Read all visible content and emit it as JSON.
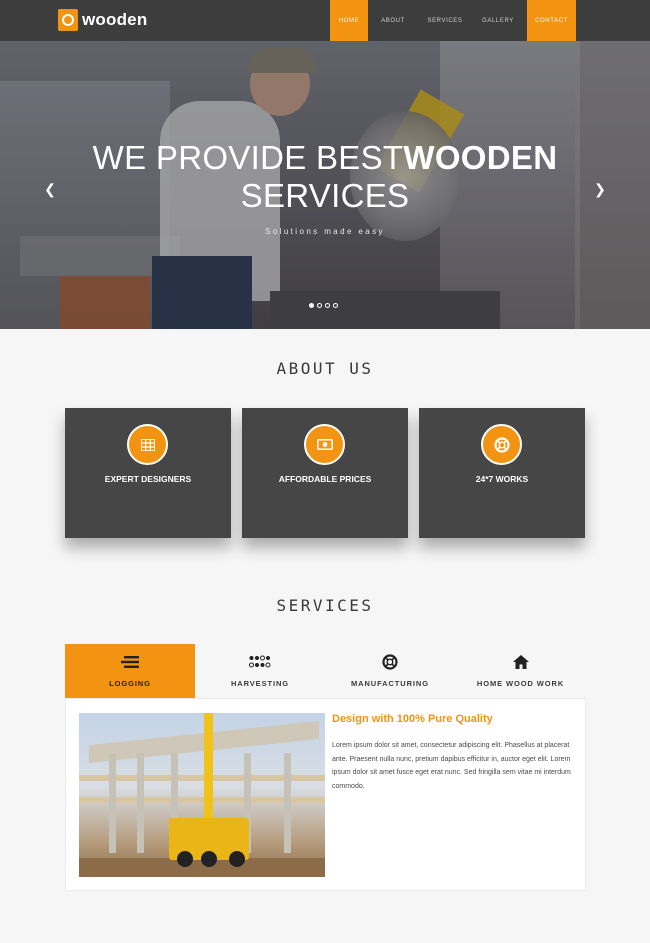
{
  "brand": {
    "name": "wooden",
    "accent": "#f29411",
    "nav_bg": "#3d3d3d"
  },
  "nav": {
    "items": [
      {
        "label": "HOME",
        "active": true
      },
      {
        "label": "ABOUT",
        "active": false
      },
      {
        "label": "SERVICES",
        "active": false
      },
      {
        "label": "GALLERY",
        "active": false
      },
      {
        "label": "CONTACT",
        "active": true
      }
    ]
  },
  "hero": {
    "title_light": "WE PROVIDE BEST",
    "title_bold": "WOODEN",
    "title_line2": "SERVICES",
    "subtitle": "Solutions made easy",
    "prev_icon": "chevron-left-icon",
    "next_icon": "chevron-right-icon",
    "slides": 4,
    "active_slide": 1
  },
  "about": {
    "title": "ABOUT US",
    "cards": [
      {
        "label": "EXPERT DESIGNERS",
        "icon": "grid-icon"
      },
      {
        "label": "AFFORDABLE PRICES",
        "icon": "money-icon"
      },
      {
        "label": "24*7 WORKS",
        "icon": "lifebuoy-icon"
      }
    ]
  },
  "services": {
    "title": "SERVICES",
    "tabs": [
      {
        "label": "LOGGING",
        "icon": "stack-icon",
        "active": true
      },
      {
        "label": "HARVESTING",
        "icon": "dots-grid-icon",
        "active": false
      },
      {
        "label": "MANUFACTURING",
        "icon": "lifebuoy-icon",
        "active": false
      },
      {
        "label": "HOME WOOD WORK",
        "icon": "home-icon",
        "active": false
      }
    ],
    "panel": {
      "heading": "Design with 100% Pure Quality",
      "body": "Lorem ipsum dolor sit amet, consectetur adipiscing elit. Phasellus at placerat ante. Praesent nulla nunc, pretium dapibus efficitur in, auctor eget elit. Lorem ipsum dolor sit amet fusce eget erat nunc. Sed fringilla sem vitae mi interdum commodo."
    }
  }
}
